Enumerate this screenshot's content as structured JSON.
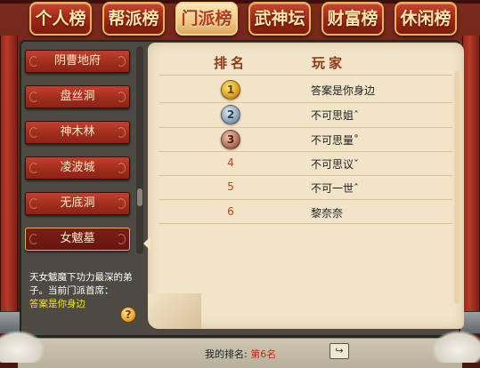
{
  "tabs": [
    {
      "label": "个人榜",
      "active": false
    },
    {
      "label": "帮派榜",
      "active": false
    },
    {
      "label": "门派榜",
      "active": true
    },
    {
      "label": "武神坛",
      "active": false
    },
    {
      "label": "财富榜",
      "active": false
    },
    {
      "label": "休闲榜",
      "active": false
    }
  ],
  "sidebar": {
    "items": [
      {
        "label": "阴曹地府",
        "selected": false
      },
      {
        "label": "盘丝洞",
        "selected": false
      },
      {
        "label": "神木林",
        "selected": false
      },
      {
        "label": "凌波城",
        "selected": false
      },
      {
        "label": "无底洞",
        "selected": false
      },
      {
        "label": "女魃墓",
        "selected": true
      }
    ],
    "description": "天女魃魔下功力最深的弟子。当前门派首席：",
    "leader": "答案是你身边",
    "help_icon_glyph": "?"
  },
  "ranking": {
    "header_rank": "排名",
    "header_player": "玩家",
    "rows": [
      {
        "rank": "1",
        "medal": "gold",
        "player": "答案是你身边"
      },
      {
        "rank": "2",
        "medal": "silver",
        "player": "不可思姐ˆ"
      },
      {
        "rank": "3",
        "medal": "bronze",
        "player": "不可思量˚"
      },
      {
        "rank": "4",
        "medal": "",
        "player": "不可思议ˇ"
      },
      {
        "rank": "5",
        "medal": "",
        "player": "不可一世ˆ"
      },
      {
        "rank": "6",
        "medal": "",
        "player": "黎奈奈"
      }
    ]
  },
  "footer": {
    "my_rank_label": "我的排名:",
    "my_rank_value": "第6名",
    "share_icon": "share-icon"
  },
  "colors": {
    "accent_red": "#c0281a",
    "leader_yellow": "#f5e500",
    "paper": "#f2e4c8"
  }
}
